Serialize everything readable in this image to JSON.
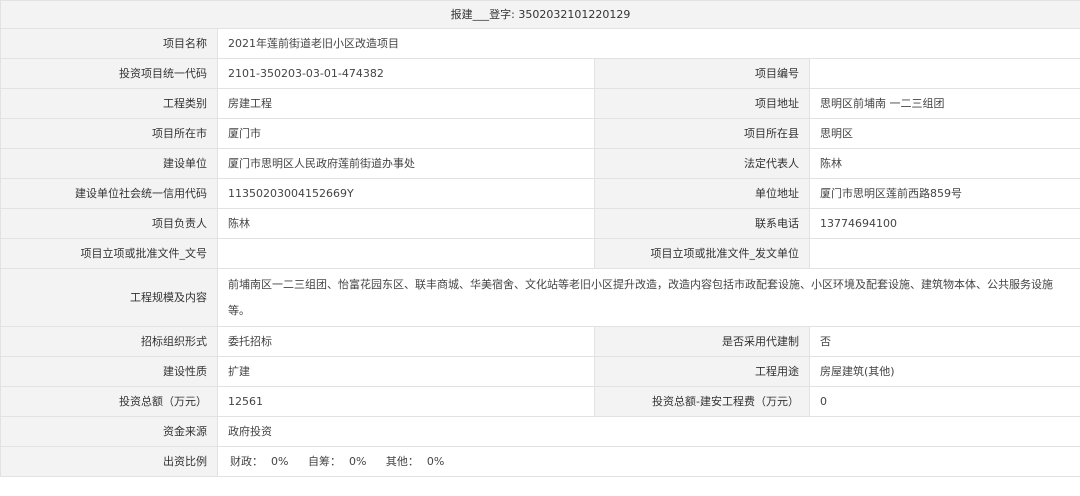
{
  "header": {
    "label": "报建___登字:",
    "code": "3502032101220129"
  },
  "project": {
    "name_label": "项目名称",
    "name_value": "2021年莲前街道老旧小区改造项目",
    "code_label": "投资项目统一代码",
    "code_value": "2101-350203-03-01-474382",
    "number_label": "项目编号",
    "number_value": "",
    "type_label": "工程类别",
    "type_value": "房建工程",
    "address_label": "项目地址",
    "address_value": "思明区前埔南 一二三组团",
    "city_label": "项目所在市",
    "city_value": "厦门市",
    "county_label": "项目所在县",
    "county_value": "思明区",
    "builder_label": "建设单位",
    "builder_value": "厦门市思明区人民政府莲前街道办事处",
    "legal_rep_label": "法定代表人",
    "legal_rep_value": "陈林",
    "credit_code_label": "建设单位社会统一信用代码",
    "credit_code_value": "11350203004152669Y",
    "unit_address_label": "单位地址",
    "unit_address_value": "厦门市思明区莲前西路859号",
    "leader_label": "项目负责人",
    "leader_value": "陈林",
    "phone_label": "联系电话",
    "phone_value": "13774694100",
    "approval_doc_label": "项目立项或批准文件_文号",
    "approval_doc_value": "",
    "approval_unit_label": "项目立项或批准文件_发文单位",
    "approval_unit_value": "",
    "scale_label": "工程规模及内容",
    "scale_value": "前埔南区一二三组团、怡富花园东区、联丰商城、华美宿舍、文化站等老旧小区提升改造，改造内容包括市政配套设施、小区环境及配套设施、建筑物本体、公共服务设施等。",
    "bidding_label": "招标组织形式",
    "bidding_value": "委托招标",
    "agent_label": "是否采用代建制",
    "agent_value": "否",
    "nature_label": "建设性质",
    "nature_value": "扩建",
    "usage_label": "工程用途",
    "usage_value": "房屋建筑(其他)",
    "invest_total_label": "投资总额（万元）",
    "invest_total_value": "12561",
    "invest_build_label": "投资总额-建安工程费（万元）",
    "invest_build_value": "0",
    "fund_source_label": "资金来源",
    "fund_source_value": "政府投资",
    "ratio_label": "出资比例",
    "ratio": {
      "finance_label": "财政：",
      "finance_value": "0%",
      "self_label": "自筹：",
      "self_value": "0%",
      "other_label": "其他：",
      "other_value": "0%"
    }
  }
}
